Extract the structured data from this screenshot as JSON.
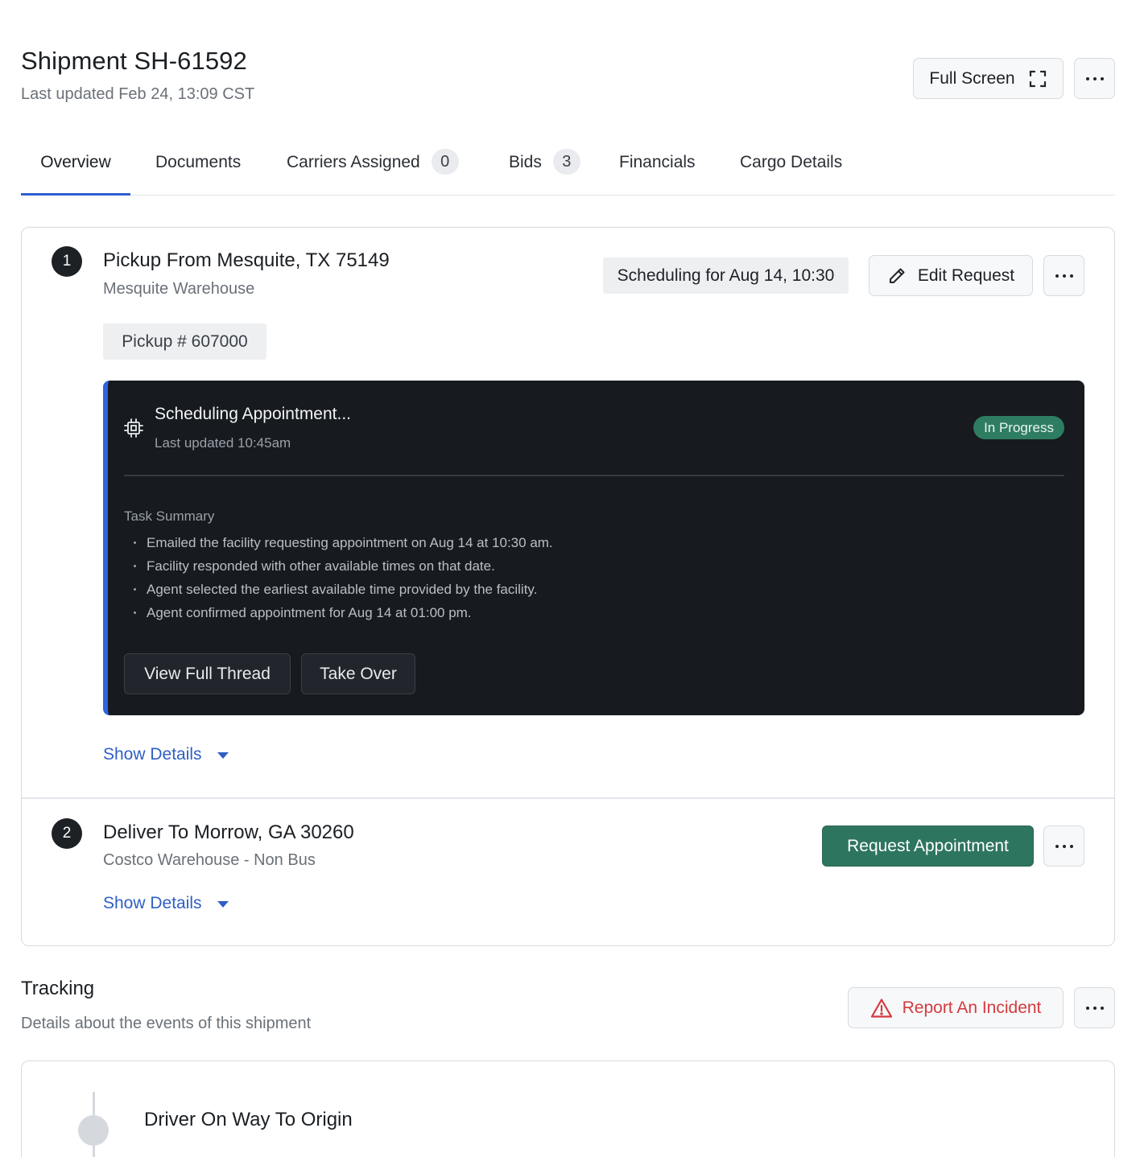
{
  "header": {
    "title": "Shipment SH-61592",
    "last_updated": "Last updated Feb 24, 13:09 CST",
    "full_screen_label": "Full Screen"
  },
  "icons": {
    "fullscreen": "expand-corners-icon",
    "more": "more-horizontal-icon",
    "edit": "pencil-icon",
    "agent": "cpu-chip-icon",
    "warning": "warning-triangle-icon",
    "caret": "caret-down-icon"
  },
  "colors": {
    "accent": "#2f5fd0",
    "success": "#2e7560",
    "danger": "#d43a3f",
    "panel_bg": "#171a1f"
  },
  "tabs": [
    {
      "label": "Overview",
      "active": true
    },
    {
      "label": "Documents"
    },
    {
      "label": "Carriers Assigned",
      "count": "0"
    },
    {
      "label": "Bids",
      "count": "3"
    },
    {
      "label": "Financials"
    },
    {
      "label": "Cargo Details"
    }
  ],
  "stops": [
    {
      "number": "1",
      "title": "Pickup From Mesquite, TX 75149",
      "location": "Mesquite Warehouse",
      "schedule_chip": "Scheduling for Aug 14, 10:30",
      "edit_label": "Edit Request",
      "pickup_number": "Pickup # 607000",
      "task": {
        "title": "Scheduling Appointment...",
        "updated": "Last updated 10:45am",
        "status": "In Progress",
        "summary_label": "Task Summary",
        "summary": [
          "Emailed the facility requesting appointment on Aug 14 at 10:30 am.",
          "Facility responded with other available times on that date.",
          "Agent selected the earliest available time provided by the facility.",
          "Agent confirmed appointment for Aug 14 at 01:00 pm."
        ],
        "view_thread_label": "View Full Thread",
        "take_over_label": "Take Over"
      },
      "show_details_label": "Show Details"
    },
    {
      "number": "2",
      "title": "Deliver To Morrow, GA 30260",
      "location": "Costco Warehouse - Non Bus",
      "request_label": "Request Appointment",
      "show_details_label": "Show Details"
    }
  ],
  "tracking": {
    "title": "Tracking",
    "subtitle": "Details about the events of this shipment",
    "report_label": "Report An Incident",
    "events": [
      {
        "label": "Driver On Way To Origin"
      }
    ]
  }
}
